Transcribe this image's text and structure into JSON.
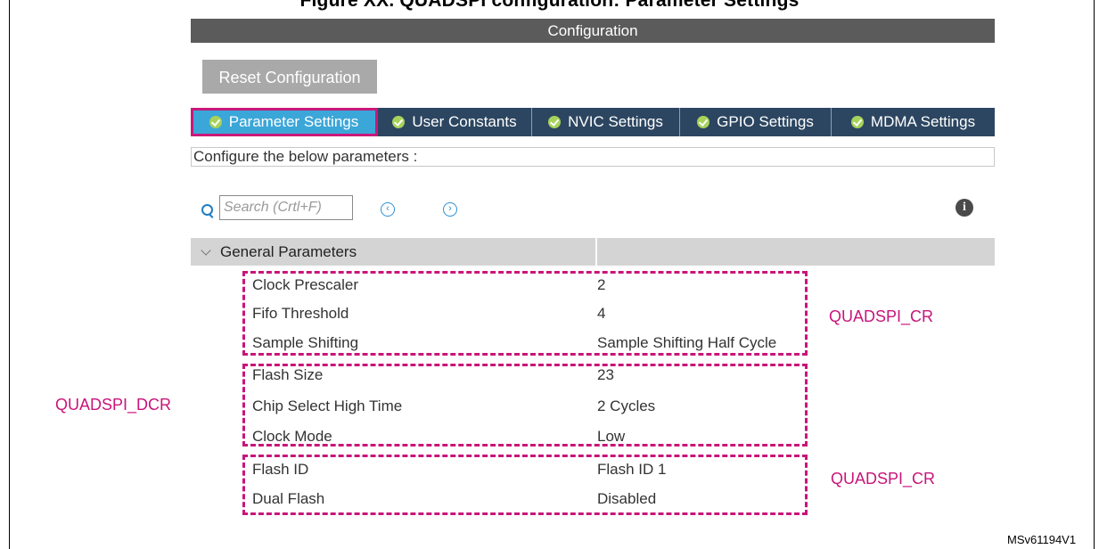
{
  "figure": {
    "title": "Figure XX. QUADSPI configuration: Parameter Settings",
    "id": "MSv61194V1"
  },
  "window": {
    "title": "Configuration"
  },
  "toolbar": {
    "reset_label": "Reset Configuration"
  },
  "tabs": [
    {
      "label": "Parameter Settings",
      "active": true
    },
    {
      "label": "User Constants",
      "active": false
    },
    {
      "label": "NVIC Settings",
      "active": false
    },
    {
      "label": "GPIO Settings",
      "active": false
    },
    {
      "label": "MDMA Settings",
      "active": false
    }
  ],
  "description": "Configure the below parameters :",
  "search": {
    "placeholder": "Search (Crtl+F)"
  },
  "nav": {
    "prev_icon": "chevron-left-circle-icon",
    "next_icon": "chevron-right-circle-icon",
    "info_icon": "info-icon"
  },
  "group": {
    "title": "General Parameters"
  },
  "parameters": [
    {
      "name": "Clock Prescaler",
      "value": "2"
    },
    {
      "name": "Fifo Threshold",
      "value": "4"
    },
    {
      "name": "Sample Shifting",
      "value": "Sample Shifting Half Cycle"
    },
    {
      "name": "Flash Size",
      "value": "23"
    },
    {
      "name": "Chip Select High Time",
      "value": "2 Cycles"
    },
    {
      "name": "Clock Mode",
      "value": "Low"
    },
    {
      "name": "Flash ID",
      "value": "Flash ID 1"
    },
    {
      "name": "Dual Flash",
      "value": "Disabled"
    }
  ],
  "annotations": {
    "cr_top": "QUADSPI_CR",
    "dcr": "QUADSPI_DCR",
    "cr_bottom": "QUADSPI_CR"
  },
  "colors": {
    "header": "#5b5b5b",
    "tab_bar": "#2c4661",
    "tab_active": "#3ba6d8",
    "highlight": "#c8157a",
    "check": "#a7d35a"
  }
}
